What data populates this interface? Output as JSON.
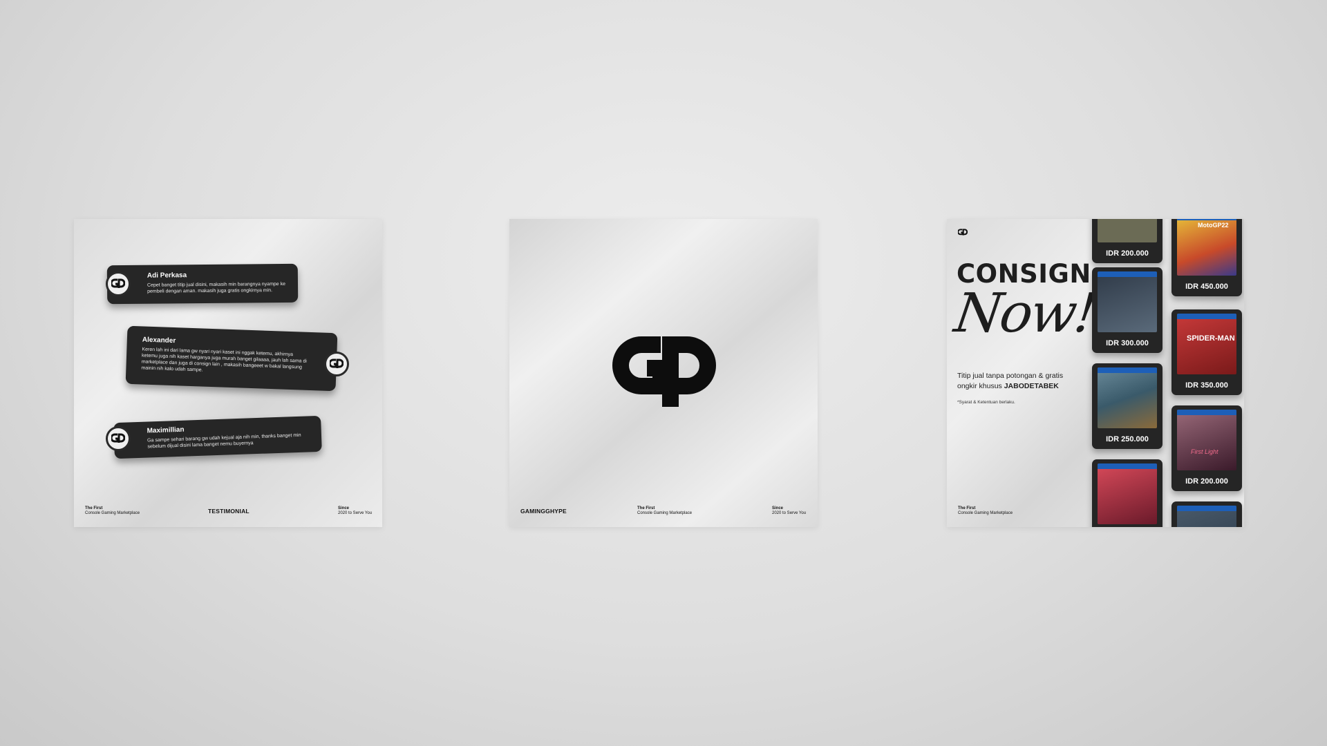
{
  "brand_name": "GAMINGGHYPE",
  "footer": {
    "first_line": "The First",
    "second_line": "Console Gaming Marketplace",
    "since_line": "Since",
    "serve_line": "2020 to Serve You"
  },
  "testimonial": {
    "label": "TESTIMONIAL",
    "items": [
      {
        "name": "Adi Perkasa",
        "text": "Cepet banget titip jual disini, makasih min barangnya nyampe ke pembeli dengan aman. makasih juga gratis ongkirnya min."
      },
      {
        "name": "Alexander",
        "text": "Keren lah ini dari lama gw nyari nyari kaset ini nggak ketemu, akhirnya ketemu juga nih kaset harganya juga murah banget gilaaaa, jauh lah sama di marketplace dan juga di consign lain , makasih bangeeet w bakal langsung mainin nih kalo udah sampe."
      },
      {
        "name": "Maximillian",
        "text": "Ga sampe sehari barang gw udah kejual aja nih min, thanks banget min sebelum dijual disini lama banget nemu buyernya"
      }
    ]
  },
  "consign": {
    "title": "CONSIGN",
    "script": "Now!",
    "desc_prefix": "Titip jual tanpa potongan & gratis ongkir khusus",
    "desc_highlight": "JABODETABEK",
    "note": "*Syarat & Ketentuan berlaku.",
    "products": [
      {
        "price": "IDR 200.000",
        "cover_color": "#6b6b55"
      },
      {
        "price": "IDR 300.000",
        "cover_color": "#3d4a5c"
      },
      {
        "price": "IDR 250.000",
        "cover_color": "#5a7a8a"
      },
      {
        "price": "",
        "cover_color": "#a33a4a"
      },
      {
        "price": "IDR 450.000",
        "cover_color": "#d4a82a"
      },
      {
        "price": "IDR 350.000",
        "cover_color": "#b82a2a"
      },
      {
        "price": "IDR 200.000",
        "cover_color": "#8a5a6a"
      },
      {
        "price": "",
        "cover_color": "#3a4a5a"
      }
    ],
    "cover_titles": [
      "MotoGP22",
      "SPIDER-MAN",
      "First Light"
    ]
  },
  "colors": {
    "dark": "#252525",
    "ps4_blue": "#1d5fb8"
  }
}
